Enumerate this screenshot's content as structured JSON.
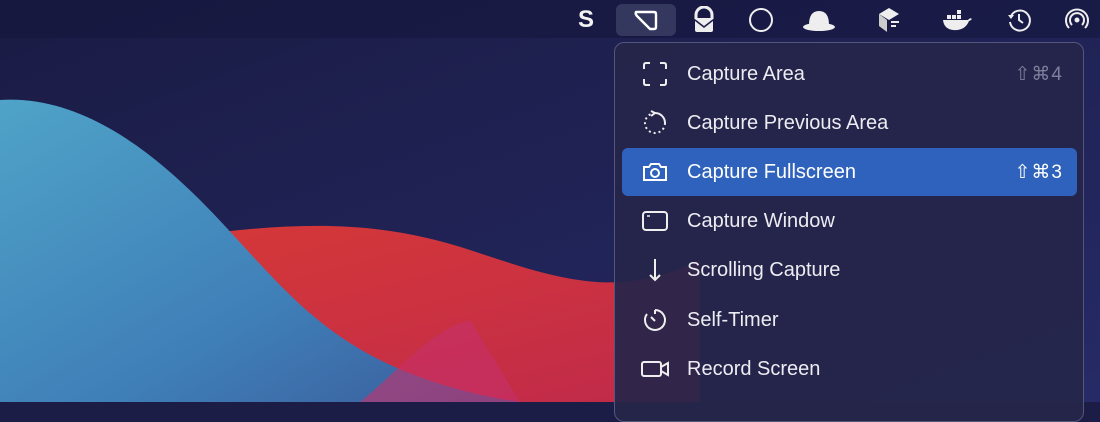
{
  "menubar": {
    "icons": [
      "setapp-s-icon",
      "screenshot-app-icon",
      "proton-mail-icon",
      "circle-icon",
      "bowler-hat-icon",
      "cube-app-icon",
      "docker-icon",
      "time-machine-icon",
      "airdrop-icon"
    ]
  },
  "menu": {
    "items": [
      {
        "label": "Capture Area",
        "shortcut": "⇧⌘4",
        "icon": "capture-area-icon"
      },
      {
        "label": "Capture Previous Area",
        "shortcut": "",
        "icon": "capture-previous-area-icon"
      },
      {
        "label": "Capture Fullscreen",
        "shortcut": "⇧⌘3",
        "icon": "camera-icon",
        "selected": true
      },
      {
        "label": "Capture Window",
        "shortcut": "",
        "icon": "window-icon"
      },
      {
        "label": "Scrolling Capture",
        "shortcut": "",
        "icon": "arrow-down-icon"
      },
      {
        "label": "Self-Timer",
        "shortcut": "",
        "icon": "timer-icon"
      },
      {
        "label": "Record Screen",
        "shortcut": "",
        "icon": "video-camera-icon"
      }
    ]
  },
  "colors": {
    "highlight": "#2f62bc",
    "menu_bg": "#26264a"
  }
}
